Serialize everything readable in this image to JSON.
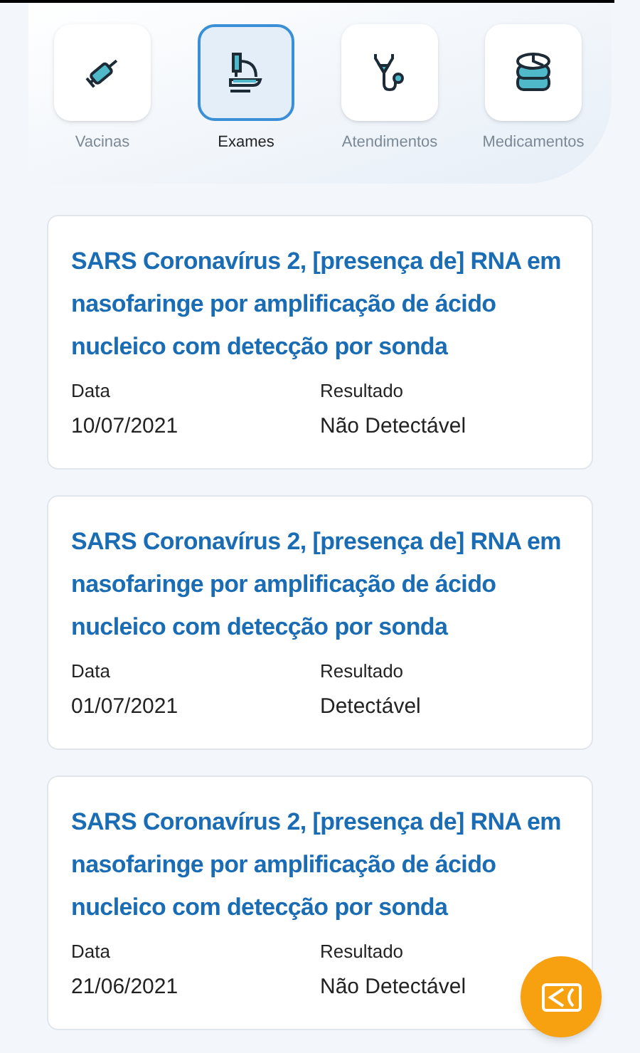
{
  "tabs": [
    {
      "label": "Vacinas",
      "kind": "syringe",
      "selected": false
    },
    {
      "label": "Exames",
      "kind": "microscope",
      "selected": true
    },
    {
      "label": "Atendimentos",
      "kind": "stethoscope",
      "selected": false
    },
    {
      "label": "Medicamentos",
      "kind": "pills",
      "selected": false
    }
  ],
  "results": [
    {
      "title": "SARS Coronavírus 2, [presença de] RNA em nasofaringe por amplificação de ácido nucleico com detecção por sonda",
      "date_label": "Data",
      "date": "10/07/2021",
      "result_label": "Resultado",
      "result": "Não Detectável"
    },
    {
      "title": "SARS Coronavírus 2, [presença de] RNA em nasofaringe por amplificação de ácido nucleico com detecção por sonda",
      "date_label": "Data",
      "date": "01/07/2021",
      "result_label": "Resultado",
      "result": "Detectável"
    },
    {
      "title": "SARS Coronavírus 2, [presença de] RNA em nasofaringe por amplificação de ácido nucleico com detecção por sonda",
      "date_label": "Data",
      "date": "21/06/2021",
      "result_label": "Resultado",
      "result": "Não Detectável"
    }
  ]
}
